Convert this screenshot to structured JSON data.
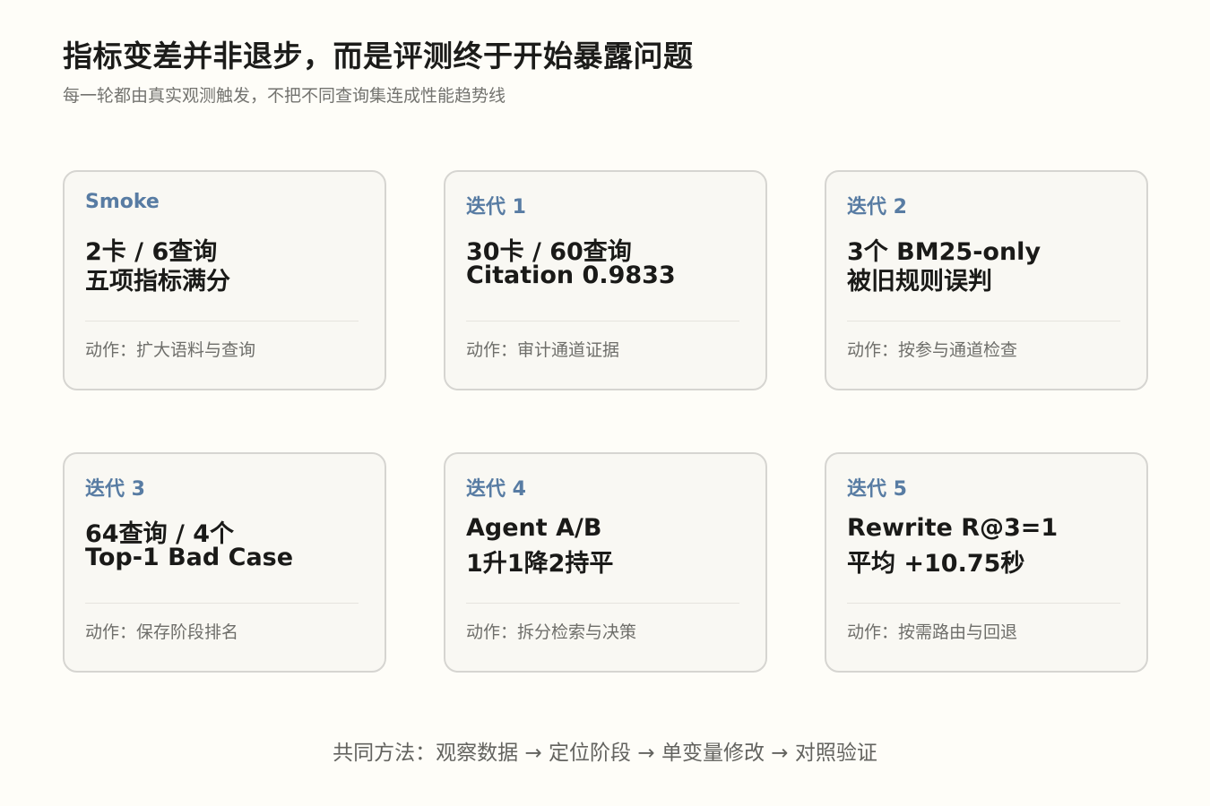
{
  "header": {
    "title": "指标变差并非退步，而是评测终于开始暴露问题",
    "subtitle": "每一轮都由真实观测触发，不把不同查询集连成性能趋势线"
  },
  "cards": [
    {
      "tag": "Smoke",
      "line1": "2卡 / 6查询",
      "line2": "五项指标满分",
      "action": "动作：扩大语料与查询"
    },
    {
      "tag": "迭代 1",
      "line1": "30卡 / 60查询",
      "line2": "Citation 0.9833",
      "action": "动作：审计通道证据"
    },
    {
      "tag": "迭代 2",
      "line1": "3个 BM25-only",
      "line2": "被旧规则误判",
      "action": "动作：按参与通道检查"
    },
    {
      "tag": "迭代 3",
      "line1": "64查询 / 4个",
      "line2": "Top-1 Bad Case",
      "action": "动作：保存阶段排名"
    },
    {
      "tag": "迭代 4",
      "line1": "Agent A/B",
      "line2": "1升1降2持平",
      "action": "动作：拆分检索与决策"
    },
    {
      "tag": "迭代 5",
      "line1": "Rewrite R@3=1",
      "line2": "平均 +10.75秒",
      "action": "动作：按需路由与回退"
    }
  ],
  "footer": {
    "text": "共同方法：观察数据 → 定位阶段 → 单变量修改 → 对照验证"
  },
  "colors": {
    "background": "#fefdf8",
    "card_background": "#f9f8f3",
    "card_border": "#d6d5d1",
    "accent": "#587ca3"
  }
}
